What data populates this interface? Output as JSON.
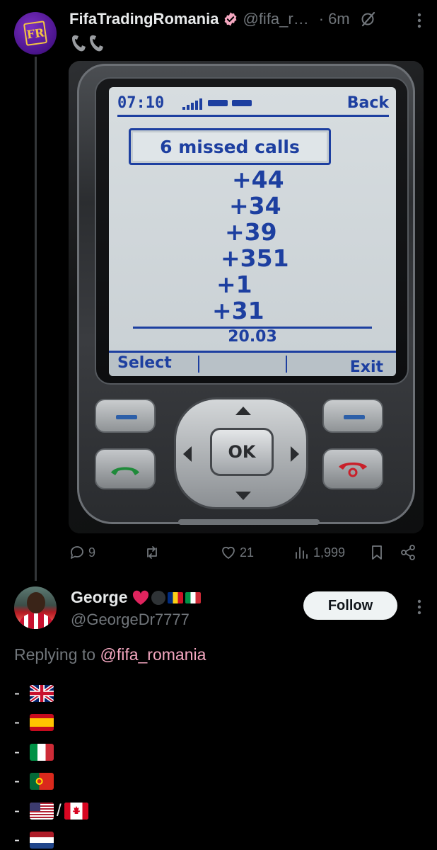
{
  "tweet": {
    "author_name": "FifaTradingRomania",
    "author_handle": "@fifa_r…",
    "separator": "·",
    "time": "6m",
    "text": "📞📞",
    "avatar_text": "FR",
    "media": {
      "screen_time": "07:10",
      "screen_back": "Back",
      "screen_title": "6 missed calls",
      "screen_list": [
        "+44",
        "+34",
        "+39",
        "+351",
        "+1",
        "+31"
      ],
      "screen_date": "20.03",
      "screen_select": "Select",
      "screen_exit": "Exit",
      "ok_key": "OK"
    },
    "actions": {
      "replies": "9",
      "reposts": "",
      "likes": "21",
      "views": "1,999"
    }
  },
  "reply": {
    "author_name": "George",
    "author_handle": "@GeorgeDr7777",
    "follow_label": "Follow",
    "replying_prefix": "Replying to",
    "replying_mention": "@fifa_romania",
    "list": [
      {
        "dash": "-",
        "flags": [
          "gb"
        ]
      },
      {
        "dash": "-",
        "flags": [
          "es"
        ]
      },
      {
        "dash": "-",
        "flags": [
          "it"
        ]
      },
      {
        "dash": "-",
        "flags": [
          "pt"
        ]
      },
      {
        "dash": "-",
        "flags": [
          "us",
          "ca"
        ],
        "joiner": "/"
      },
      {
        "dash": "-",
        "flags": [
          "nl"
        ]
      }
    ]
  },
  "colors": {
    "background": "#000000",
    "text_primary": "#e7e9ea",
    "text_secondary": "#71767b",
    "mention": "#f4a7c0",
    "verified_badge": "#f4a7c0",
    "screen_blue": "#1d3fa0"
  }
}
